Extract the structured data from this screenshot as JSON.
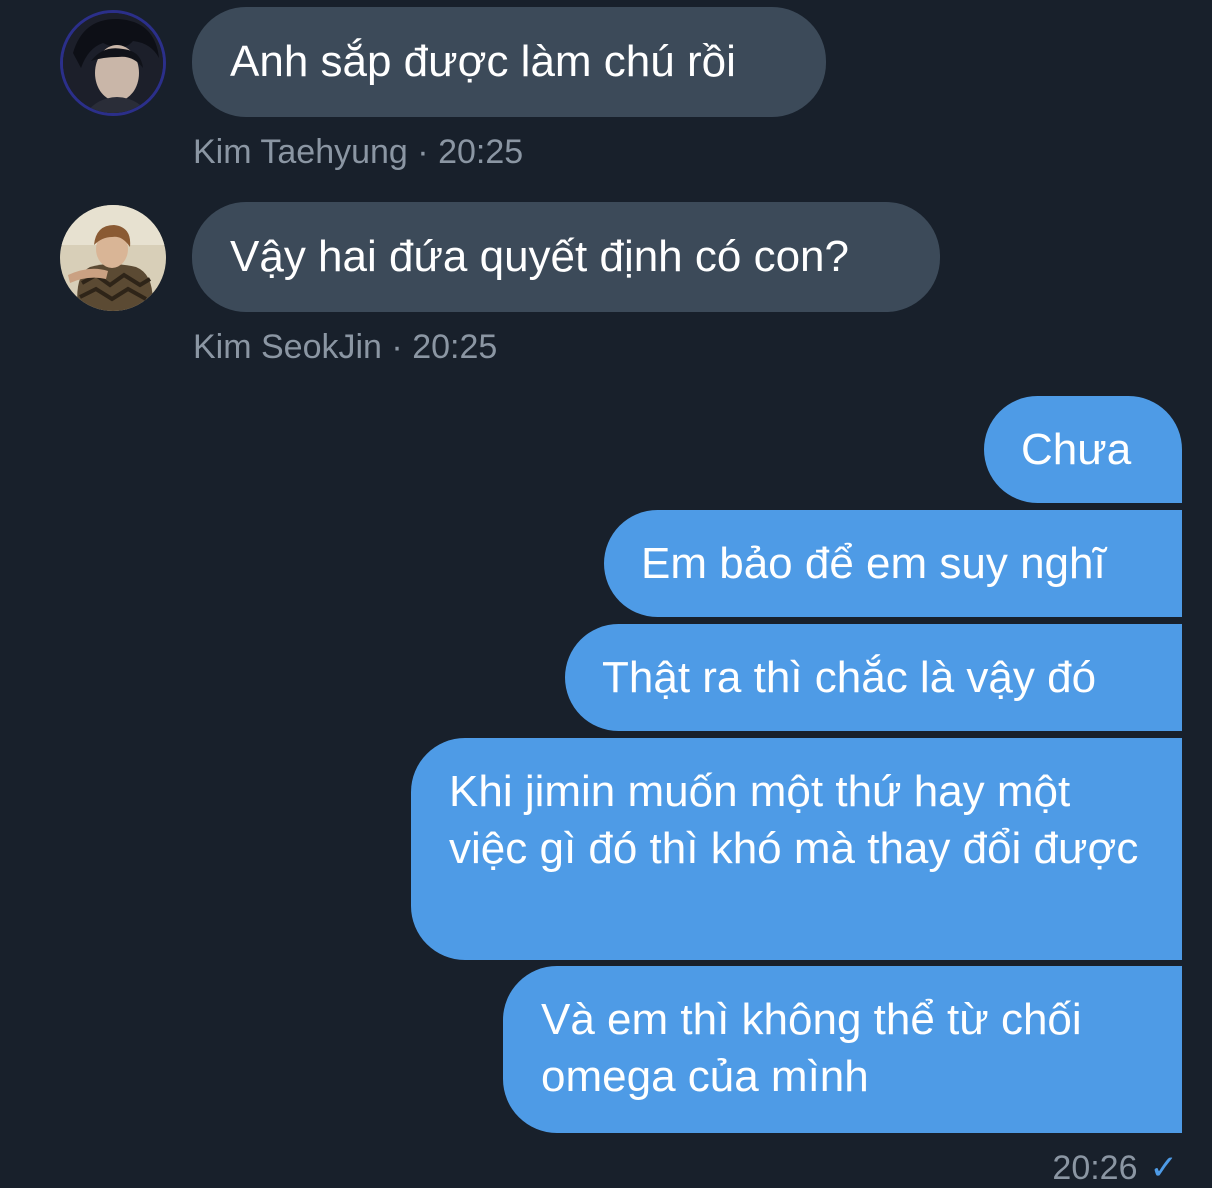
{
  "messages_in": [
    {
      "sender": "Kim Taehyung",
      "time": "20:25",
      "text": "Anh sắp được làm chú rồi",
      "separator": "·"
    },
    {
      "sender": "Kim SeokJin",
      "time": "20:25",
      "text": "Vậy hai đứa quyết định có con?",
      "separator": "·"
    }
  ],
  "messages_out": [
    {
      "text": "Chưa"
    },
    {
      "text": "Em bảo để em suy nghĩ"
    },
    {
      "text": "Thật ra thì chắc là vậy đó"
    },
    {
      "text": "Khi jimin muốn một thứ hay một việc gì đó thì khó mà thay đổi được"
    },
    {
      "text": "Và em thì không thể từ chối omega của mình"
    }
  ],
  "outgoing_meta": {
    "time": "20:26",
    "status_icon": "checkmark-icon",
    "status_glyph": "✓"
  },
  "colors": {
    "background": "#18202b",
    "incoming_bubble": "#3c4a59",
    "outgoing_bubble": "#4e9be6",
    "meta_text": "#8b96a3"
  }
}
